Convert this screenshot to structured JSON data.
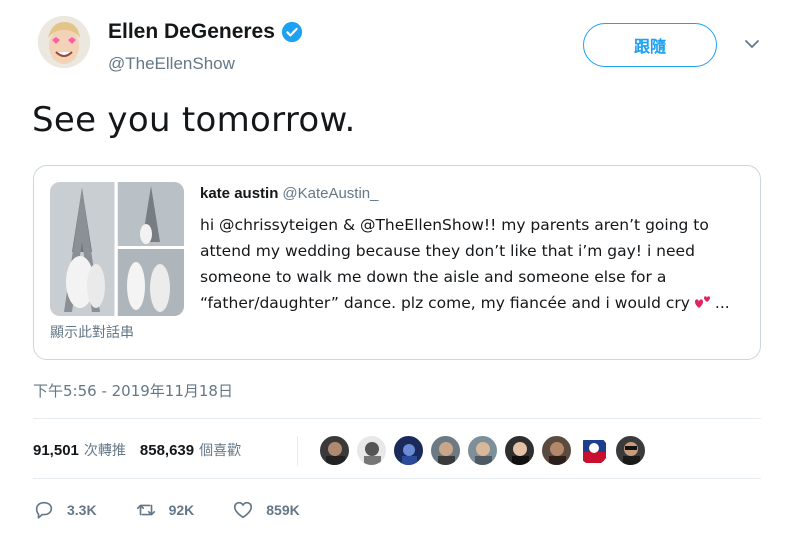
{
  "author": {
    "name": "Ellen DeGeneres",
    "handle": "@TheEllenShow",
    "verified": true
  },
  "follow_label": "跟隨",
  "tweet_text": "See you tomorrow.",
  "quoted": {
    "name": "kate austin",
    "handle": "@KateAustin_",
    "lines": [
      "hi @chrissyteigen & @TheEllenShow!! my parents aren’t going to",
      "attend my wedding because they don’t like that i’m gay! i need",
      "someone to walk me down the aisle and someone else for a",
      "“father/daughter” dance. plz come, my fiancée and i would cry"
    ],
    "ellipsis": "...",
    "show_thread": "顯示此對話串"
  },
  "timestamp": "下午5:56 - 2019年11月18日",
  "stats": {
    "retweets_count": "91,501",
    "retweets_label": "次轉推",
    "likes_count": "858,639",
    "likes_label": "個喜歡"
  },
  "actions": {
    "reply_count": "3.3K",
    "retweet_count": "92K",
    "like_count": "859K"
  },
  "colors": {
    "accent": "#1da1f2",
    "secondary_text": "#657786",
    "border": "#ccd6dd"
  }
}
